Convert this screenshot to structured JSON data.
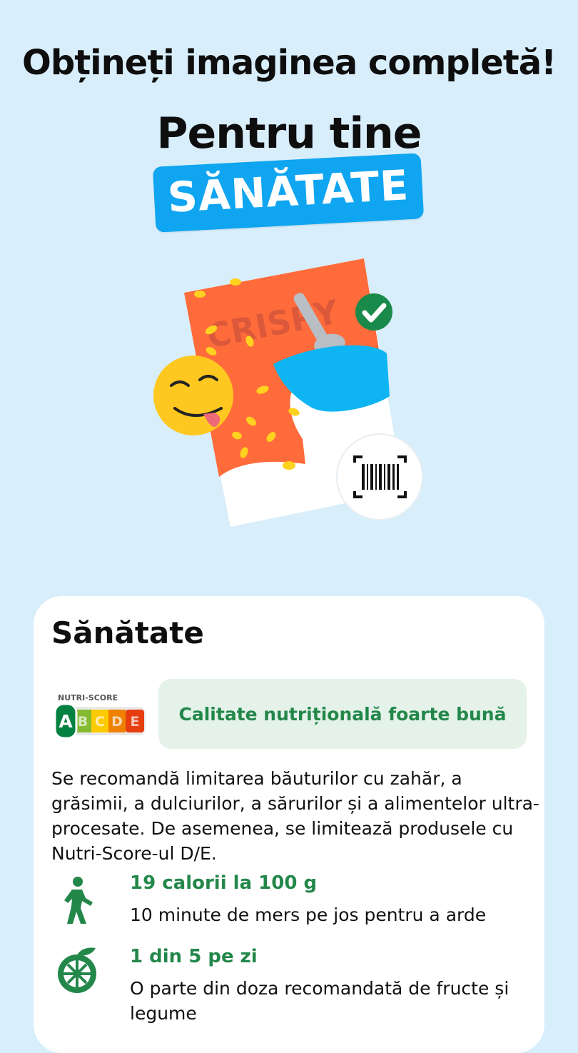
{
  "header": {
    "headline": "Obțineți imaginea completă!",
    "subhead": "Pentru tine",
    "banner": "SĂNĂTATE"
  },
  "illustration": {
    "package_text": "CRISPY",
    "icons": [
      "smiley-tongue-icon",
      "checkmark-icon",
      "barcode-icon",
      "spoon-icon"
    ]
  },
  "health": {
    "title": "Sănătate",
    "nutri_score": {
      "label": "NUTRI-SCORE",
      "grades": [
        "A",
        "B",
        "C",
        "D",
        "E"
      ],
      "selected": "A",
      "colors": [
        "#038141",
        "#85bb2f",
        "#fecb02",
        "#ee8100",
        "#e63e11"
      ]
    },
    "quality": "Calitate nutrițională foarte bună",
    "advice": "Se recomandă limitarea băuturilor cu zahăr, a grăsimii, a dulciurilor, a sărurilor și a alimentelor ultra-procesate. De asemenea, se limitează produsele cu Nutri-Score-ul D/E.",
    "facts": [
      {
        "icon": "walking-person-icon",
        "title": "19 calorii la 100 g",
        "text": "10 minute de mers pe jos pentru a arde"
      },
      {
        "icon": "fruit-icon",
        "title": "1 din 5 pe zi",
        "text": "O parte din doza recomandată de fructe și legume"
      }
    ]
  },
  "colors": {
    "background": "#d8eefb",
    "banner": "#10a5f0",
    "green": "#23874a"
  }
}
